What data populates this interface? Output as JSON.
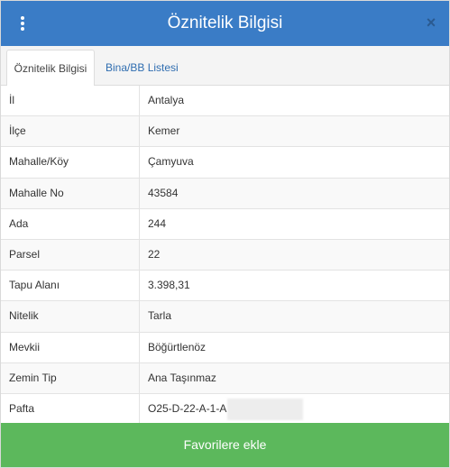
{
  "header": {
    "title": "Öznitelik Bilgisi",
    "close_label": "×"
  },
  "tabs": [
    {
      "label": "Öznitelik Bilgisi",
      "active": true
    },
    {
      "label": "Bina/BB Listesi",
      "active": false
    }
  ],
  "attributes": [
    {
      "key": "İl",
      "value": "Antalya"
    },
    {
      "key": "İlçe",
      "value": "Kemer"
    },
    {
      "key": "Mahalle/Köy",
      "value": "Çamyuva"
    },
    {
      "key": "Mahalle No",
      "value": "43584"
    },
    {
      "key": "Ada",
      "value": "244"
    },
    {
      "key": "Parsel",
      "value": "22"
    },
    {
      "key": "Tapu Alanı",
      "value": "3.398,31"
    },
    {
      "key": "Nitelik",
      "value": "Tarla"
    },
    {
      "key": "Mevkii",
      "value": "Böğürtlenöz"
    },
    {
      "key": "Zemin Tip",
      "value": "Ana Taşınmaz"
    },
    {
      "key": "Pafta",
      "value": "O25-D-22-A-1-A"
    }
  ],
  "footer": {
    "favorite_label": "Favorilere ekle"
  },
  "colors": {
    "header": "#3a7cc6",
    "favorite_button": "#5cb85c",
    "tab_link": "#2f6db0"
  },
  "icons": {
    "menu": "vertical-dots-icon",
    "close": "close-icon"
  }
}
